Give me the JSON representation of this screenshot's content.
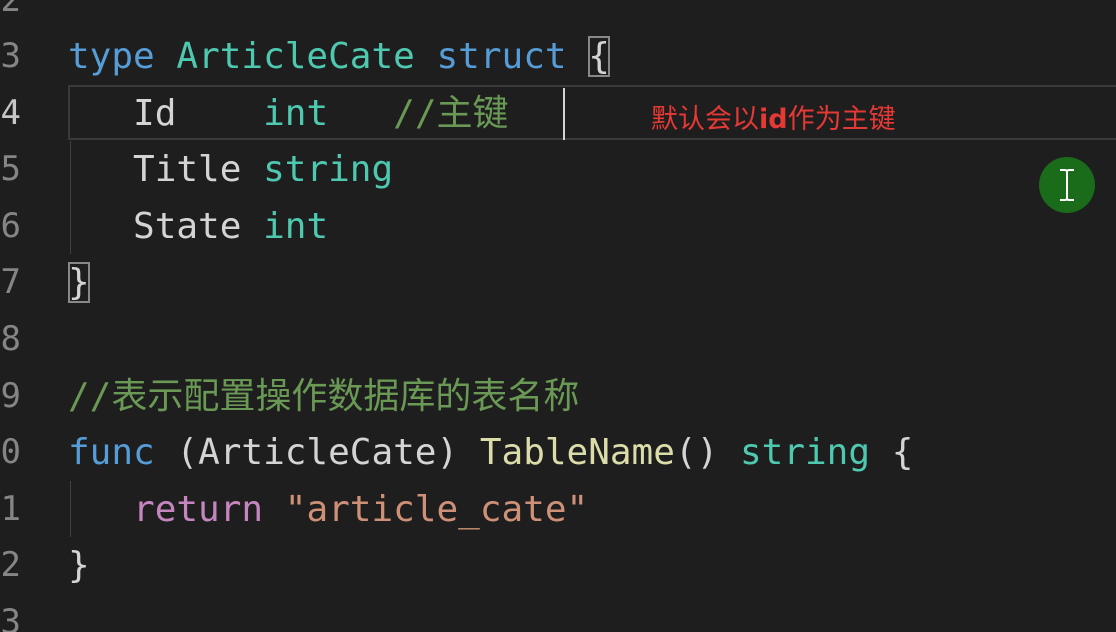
{
  "editor": {
    "line_numbers": [
      "2",
      "3",
      "4",
      "5",
      "6",
      "7",
      "8",
      "9",
      "0",
      "1",
      "2"
    ],
    "lines": {
      "l3": {
        "t1": "type",
        "t2": "ArticleCate",
        "t3": "struct",
        "t4": "{"
      },
      "l4": {
        "t1": "Id",
        "t2": "int",
        "t3": "//主键"
      },
      "l5": {
        "t1": "Title",
        "t2": "string"
      },
      "l6": {
        "t1": "State",
        "t2": "int"
      },
      "l7": {
        "t1": "}"
      },
      "l9": {
        "t1": "//表示配置操作数据库的表名称"
      },
      "l10": {
        "t1": "func",
        "t2": "(ArticleCate)",
        "t3": "TableName",
        "t4": "()",
        "t5": "string",
        "t6": "{"
      },
      "l11": {
        "t1": "return",
        "t2": "\"article_cate\""
      },
      "l12": {
        "t1": "}"
      }
    }
  },
  "annotation": {
    "text_before": "默认会以",
    "text_bold": "id",
    "text_after": "作为主键"
  },
  "cursor_badge": {
    "icon": "text-cursor-icon",
    "color": "#1a6b1a"
  },
  "colors": {
    "background": "#1e1e1e",
    "keyword": "#569cd6",
    "type": "#4ec9b0",
    "function": "#dcdcaa",
    "comment": "#6a9955",
    "control": "#c586c0",
    "string": "#ce9178",
    "annotation": "#e53935"
  }
}
